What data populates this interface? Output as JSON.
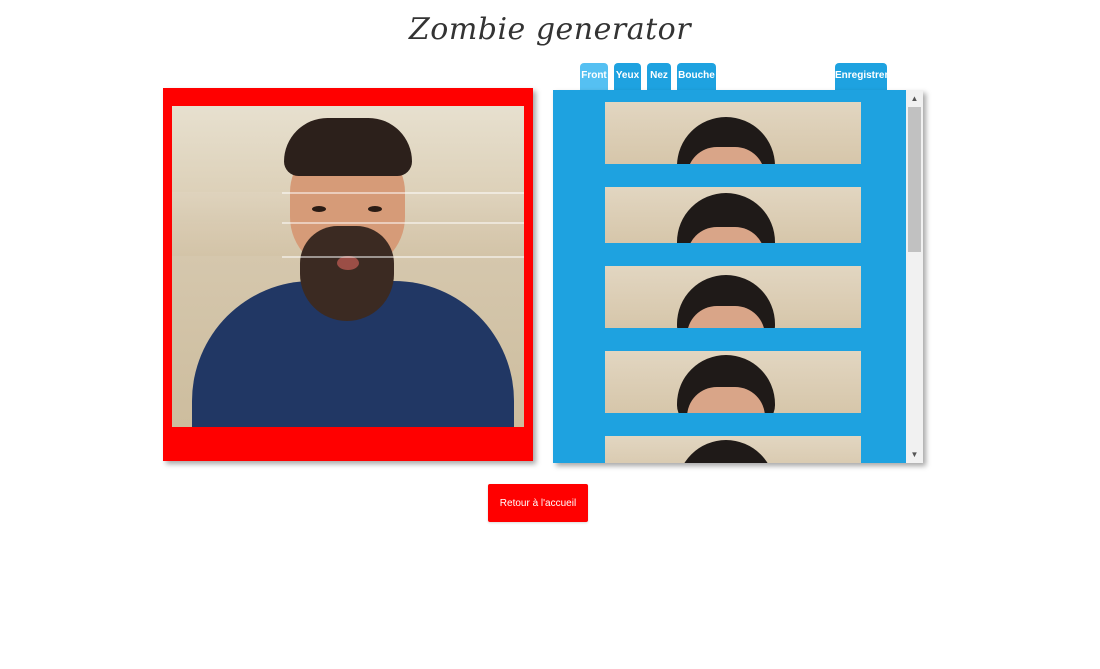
{
  "header": {
    "title": "Zombie generator"
  },
  "tabs": [
    {
      "label": "Front",
      "active": true
    },
    {
      "label": "Yeux",
      "active": false
    },
    {
      "label": "Nez",
      "active": false
    },
    {
      "label": "Bouche",
      "active": false
    }
  ],
  "save": {
    "label": "Enregistrer"
  },
  "footer": {
    "home_label": "Retour à l'accueil"
  },
  "colors": {
    "preview_frame": "#ff0000",
    "chooser_bg": "#1ea2e0",
    "tab": "#1ea2e0",
    "tab_active": "#55c0f2",
    "button": "#ff0000"
  },
  "chooser": {
    "category": "Front",
    "visible_thumbnails": 5
  }
}
